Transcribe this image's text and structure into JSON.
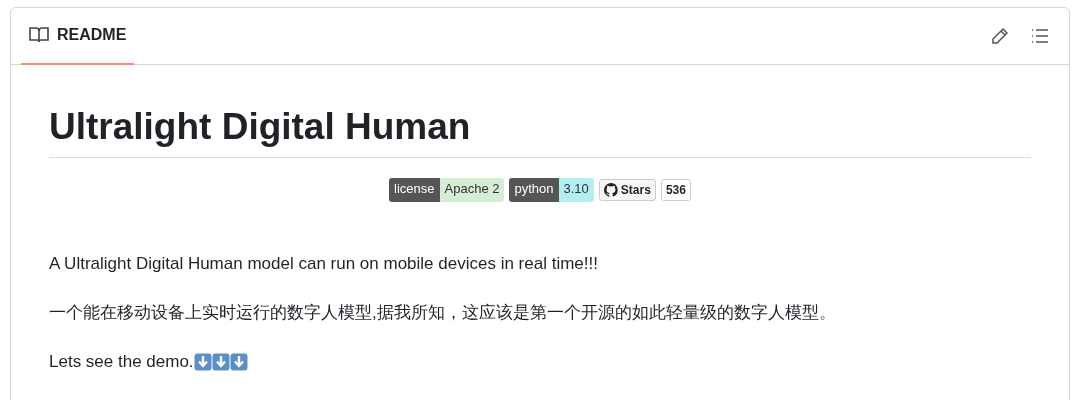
{
  "header": {
    "tab": {
      "label": "README",
      "selected": true
    }
  },
  "title": "Ultralight Digital Human",
  "badges": [
    {
      "kind": "shield",
      "label": "license",
      "value": "Apache 2",
      "color": "#d4edd4"
    },
    {
      "kind": "shield",
      "label": "python",
      "value": "3.10",
      "color": "#b3eef0"
    },
    {
      "kind": "stars",
      "label": "Stars",
      "value": "536"
    }
  ],
  "paragraphs": [
    "A Ultralight Digital Human model can run on mobile devices in real time!!!",
    "一个能在移动设备上实时运行的数字人模型,据我所知，这应该是第一个开源的如此轻量级的数字人模型。"
  ],
  "demo_line": "Lets see the demo."
}
